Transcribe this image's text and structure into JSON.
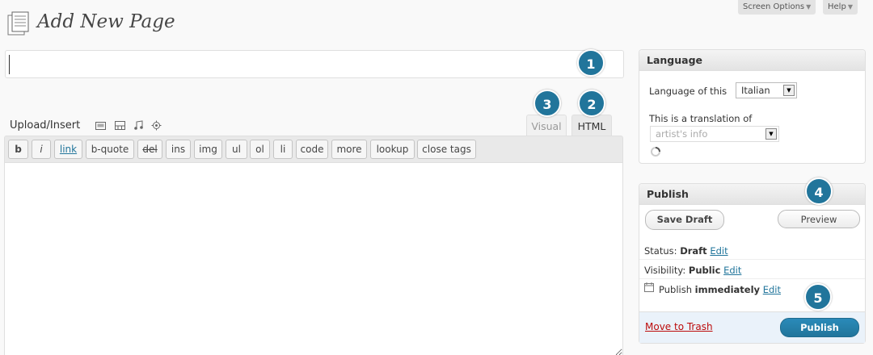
{
  "header": {
    "title": "Add New Page",
    "screen_options": "Screen Options",
    "help": "Help"
  },
  "title_field": {
    "value": ""
  },
  "badges": [
    "1",
    "2",
    "3",
    "4",
    "5"
  ],
  "editor": {
    "upload_label": "Upload/Insert",
    "media_icons": [
      "image-icon",
      "video-icon",
      "audio-icon",
      "media-icon"
    ],
    "tabs": {
      "visual": "Visual",
      "html": "HTML"
    },
    "quicktags": [
      "b",
      "i",
      "link",
      "b-quote",
      "del",
      "ins",
      "img",
      "ul",
      "ol",
      "li",
      "code",
      "more",
      "lookup",
      "close tags"
    ]
  },
  "language_box": {
    "title": "Language",
    "language_label": "Language of this",
    "language_value": "Italian",
    "translation_label": "This is a translation of",
    "translation_placeholder": "artist's info"
  },
  "publish_box": {
    "title": "Publish",
    "save_draft": "Save Draft",
    "preview": "Preview",
    "status_label": "Status:",
    "status_value": "Draft",
    "visibility_label": "Visibility:",
    "visibility_value": "Public",
    "publish_label": "Publish",
    "publish_value": "immediately",
    "edit": "Edit",
    "move_to_trash": "Move to Trash",
    "publish_button": "Publish"
  },
  "colors": {
    "accent": "#21759b",
    "trash": "#bc0b0b"
  }
}
